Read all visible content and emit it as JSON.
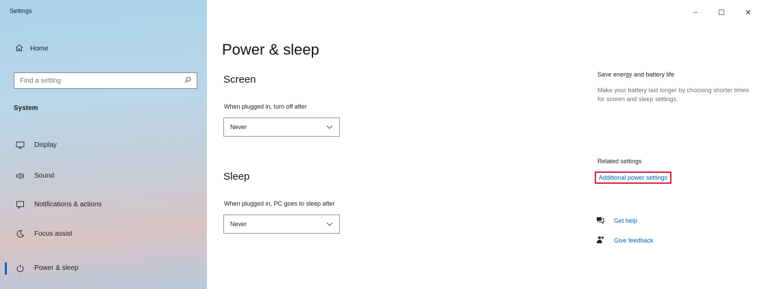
{
  "window": {
    "title": "Settings",
    "minimize_glyph": "–",
    "maximize_glyph": "☐",
    "close_glyph": "✕"
  },
  "sidebar": {
    "home_label": "Home",
    "search_placeholder": "Find a setting",
    "section_label": "System",
    "items": [
      {
        "label": "Display",
        "icon": "display-icon"
      },
      {
        "label": "Sound",
        "icon": "sound-icon"
      },
      {
        "label": "Notifications & actions",
        "icon": "notifications-icon"
      },
      {
        "label": "Focus assist",
        "icon": "moon-icon"
      },
      {
        "label": "Power & sleep",
        "icon": "power-icon",
        "active": true
      }
    ]
  },
  "main": {
    "title": "Power & sleep",
    "screen": {
      "heading": "Screen",
      "label": "When plugged in, turn off after",
      "value": "Never"
    },
    "sleep": {
      "heading": "Sleep",
      "label": "When plugged in, PC goes to sleep after",
      "value": "Never"
    }
  },
  "right": {
    "tip_heading": "Save energy and battery life",
    "tip_body": "Make your battery last longer by choosing shorter times for screen and sleep settings.",
    "related_heading": "Related settings",
    "related_link": "Additional power settings",
    "get_help": "Get help",
    "give_feedback": "Give feedback"
  },
  "colors": {
    "accent": "#0067c0",
    "link": "#0063b1",
    "highlight_border": "#d6213a"
  }
}
